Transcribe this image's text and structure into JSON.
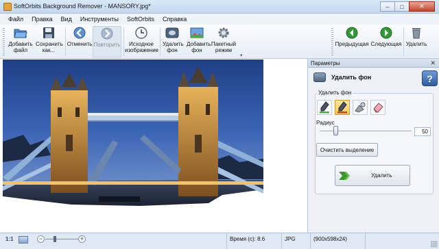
{
  "window": {
    "title": "SoftOrbits Background Remover - MANSORY.jpg*",
    "minimize": "–",
    "maximize": "□",
    "close": "✕"
  },
  "menu": [
    {
      "label": "Файл"
    },
    {
      "label": "Правка"
    },
    {
      "label": "Вид"
    },
    {
      "label": "Инструменты"
    },
    {
      "label": "SoftOrbits"
    },
    {
      "label": "Справка"
    }
  ],
  "toolbar": {
    "add_file": "Добавить файл",
    "save_as": "Сохранить как...",
    "undo": "Отменить",
    "redo": "Повторить",
    "original": "Исходное изображение",
    "remove_bg": "Удалить фон",
    "add_bg": "Добавить фон",
    "batch": "Пакетный режим",
    "prev": "Предыдущая",
    "next": "Следующая",
    "delete": "Удалить",
    "more": "▾"
  },
  "icons": {
    "add_file": "folder-open-icon",
    "save_as": "floppy-disk-icon",
    "undo": "arrow-left-icon",
    "redo": "arrow-right-icon",
    "original": "clock-icon",
    "remove_bg": "remove-background-icon",
    "add_bg": "add-background-icon",
    "batch": "gear-icon",
    "prev": "green-left-arrow-icon",
    "next": "green-right-arrow-icon",
    "delete": "trash-icon"
  },
  "panel": {
    "header": "Параметры",
    "close": "✕",
    "title": "Удалить фон",
    "help": "?",
    "group_label": "Удалить фон",
    "radius_label": "Радиус",
    "radius_value": "50",
    "radius_level": 0.17,
    "clear_selection": "Очистить выделение",
    "remove": "Удалить"
  },
  "status": {
    "zoom_11": "1:1",
    "zoom_minus": "−",
    "zoom_plus": "+",
    "time": "Время (с): 8.6",
    "format": "JPG",
    "dimensions": "(900x598x24)"
  },
  "colors": {
    "accent": "#2e5d9e",
    "green_nav": "#2f9a33",
    "marker_green": "#3fb23f",
    "marker_red": "#d53a2f"
  }
}
